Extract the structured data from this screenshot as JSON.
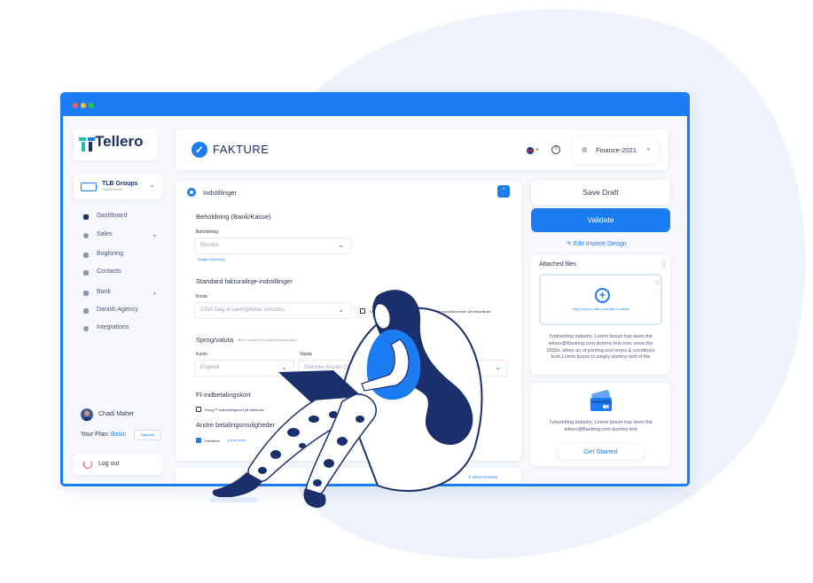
{
  "app": {
    "brand": "Tellero",
    "company": {
      "name": "TLB Groups",
      "subtitle": "Checkaccount"
    },
    "nav": [
      {
        "label": "Dashboard",
        "icon": "dashboard-icon"
      },
      {
        "label": "Sales",
        "icon": "sales-icon"
      },
      {
        "label": "Bogforing",
        "icon": "bookkeeping-icon"
      },
      {
        "label": "Contacts",
        "icon": "contacts-icon"
      },
      {
        "label": "Bank",
        "icon": "bank-icon"
      },
      {
        "label": "Danish Agency",
        "icon": "agency-icon"
      },
      {
        "label": "Integrations",
        "icon": "integrations-icon"
      }
    ],
    "user": {
      "name": "Chadi Maher"
    },
    "plan": {
      "label": "Your Plan:",
      "value": "Basic",
      "upgrade": "Upgrade"
    },
    "logout": "Log out"
  },
  "header": {
    "title": "FAKTURE",
    "project": "Finance-2021"
  },
  "settings": {
    "title": "Indstillinger",
    "sections": {
      "holding": {
        "title": "Beholdning",
        "title_suffix": "(Bank/Kasse)",
        "field_label": "Beholdning",
        "value": "Revolut",
        "link": "Rediger beholdning"
      },
      "invoice_line": {
        "title": "Standard fakturalinje-indstillinger",
        "field_label": "Konto",
        "value": "1000-Salg af varer/ydelser m/moms",
        "checkbox1_label": "Vis",
        "checkbox2_label": "Tilføj produktnummer på fakturalinjer"
      },
      "language": {
        "title": "Sprog/valuta",
        "subtitle": "(Bliver opdateret hos dig/forhandlerkontakt)",
        "field1_label": "Konto",
        "field1_value": "Engelsk",
        "field2_label": "Valuta",
        "field2_value": "Svenske Kroner (SEK)"
      },
      "fi": {
        "title": "FI-indbetalingskort",
        "checkbox_label": "Smug™ Indbetalingskort på fakturaen"
      },
      "payment": {
        "title": "Andre betalingsmuligheder",
        "checkbox_label": "Kreditkort",
        "link": "(Learn more)"
      }
    },
    "preview": "Show Preview"
  },
  "right": {
    "save_draft": "Save Draft",
    "validate": "Validate",
    "edit_design": "Edit Invoice Design",
    "attached_title": "Attached files",
    "drop_hint": "Drag & drop or click to add files to upload",
    "attached_text": "Typesetting industry. Lorem Ipsum has been the tellero@Banking.com dummy text ever since the 1500s, when an of printing and terms & conditions took.Lorem Ipsum is simply dummy text of the",
    "promo_text": "Typesetting industry. Lorem Ipsum has been the tellero@Banking.com dummy text",
    "get_started": "Get Started"
  },
  "colors": {
    "primary": "#1c7cf2",
    "navy": "#1a2f6b",
    "danger": "#ef4444",
    "dot_red": "#ff5f57",
    "dot_yellow": "#ffbd2e",
    "dot_green": "#28c840"
  }
}
